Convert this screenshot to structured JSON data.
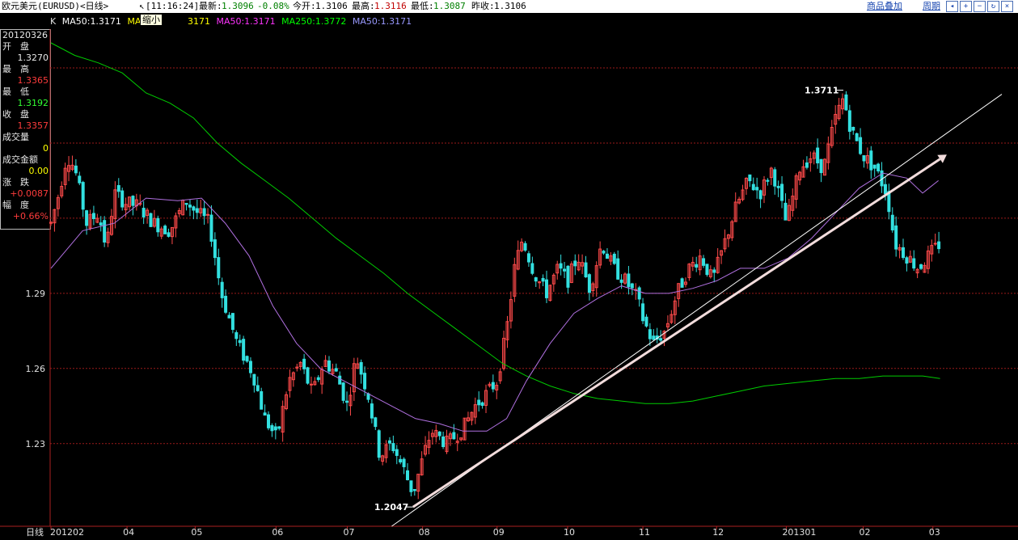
{
  "header": {
    "title": "欧元美元(EURUSD)<日线>",
    "time": "[11:16:24]",
    "latest_label": "最新:",
    "latest": "1.3096",
    "change": "-0.08%",
    "open_label": "今开:",
    "open": "1.3106",
    "high_label": "最高:",
    "high": "1.3116",
    "low_label": "最低:",
    "low": "1.3087",
    "prev_label": "昨收:",
    "prev": "1.3106",
    "overlay_link": "商品叠加",
    "period_link": "周期"
  },
  "tooltip": "缩小",
  "legend": [
    {
      "text": "K",
      "color": "#e0e0e0"
    },
    {
      "text": "MA50:1.3171",
      "color": "#ffffff"
    },
    {
      "text": "MA",
      "color": "#ffff00"
    },
    {
      "text": "3171",
      "color": "#ffff00"
    },
    {
      "text": "MA50:1.3171",
      "color": "#ff33ff"
    },
    {
      "text": "MA250:1.3772",
      "color": "#00ff00"
    },
    {
      "text": "MA50:1.3171",
      "color": "#9999ff"
    }
  ],
  "info_panel": {
    "date": "20120326",
    "rows": [
      {
        "label": "开　盘",
        "value": "1.3270",
        "color": "#e8e8e8"
      },
      {
        "label": "最　高",
        "value": "1.3365",
        "color": "#ff3c3c"
      },
      {
        "label": "最　低",
        "value": "1.3192",
        "color": "#33ff33"
      },
      {
        "label": "收　盘",
        "value": "1.3357",
        "color": "#ff3c3c"
      },
      {
        "label": "成交量",
        "value": "0",
        "color": "#ffff00"
      },
      {
        "label": "成交金额",
        "value": "0.00",
        "color": "#ffff00"
      },
      {
        "label": "涨　跌",
        "value": "+0.0087",
        "color": "#ff3c3c"
      },
      {
        "label": "幅　度",
        "value": "+0.66%",
        "color": "#ff3c3c"
      }
    ]
  },
  "chart_data": {
    "type": "candlestick",
    "ylim": [
      1.197,
      1.3955
    ],
    "yticks": [
      1.23,
      1.26,
      1.29
    ],
    "ytick_labels": [
      "1.23",
      "1.26",
      "1.29"
    ],
    "gridlines": [
      1.23,
      1.26,
      1.29,
      1.32,
      1.35,
      1.38
    ],
    "xaxis_label": "日线",
    "xticks": [
      {
        "label": "201202",
        "x": 0
      },
      {
        "label": "04",
        "x": 0.096
      },
      {
        "label": "05",
        "x": 0.182
      },
      {
        "label": "06",
        "x": 0.284
      },
      {
        "label": "07",
        "x": 0.374
      },
      {
        "label": "08",
        "x": 0.469
      },
      {
        "label": "09",
        "x": 0.563
      },
      {
        "label": "10",
        "x": 0.652
      },
      {
        "label": "11",
        "x": 0.747
      },
      {
        "label": "12",
        "x": 0.84
      },
      {
        "label": "201301",
        "x": 0.928
      },
      {
        "label": "02",
        "x": 1.025
      },
      {
        "label": "03",
        "x": 1.113
      }
    ],
    "annotations": [
      {
        "text": "1.3711",
        "x": 1.0,
        "value": 1.3711
      },
      {
        "text": "1.2047",
        "x": 0.457,
        "value": 1.2047
      }
    ],
    "price_path": [
      [
        0.0,
        1.318
      ],
      [
        0.01,
        1.33
      ],
      [
        0.02,
        1.345
      ],
      [
        0.03,
        1.34
      ],
      [
        0.045,
        1.318
      ],
      [
        0.06,
        1.322
      ],
      [
        0.07,
        1.308
      ],
      [
        0.08,
        1.33
      ],
      [
        0.095,
        1.326
      ],
      [
        0.11,
        1.325
      ],
      [
        0.13,
        1.318
      ],
      [
        0.15,
        1.315
      ],
      [
        0.17,
        1.327
      ],
      [
        0.182,
        1.323
      ],
      [
        0.2,
        1.318
      ],
      [
        0.215,
        1.29
      ],
      [
        0.235,
        1.27
      ],
      [
        0.255,
        1.258
      ],
      [
        0.27,
        1.24
      ],
      [
        0.285,
        1.232
      ],
      [
        0.3,
        1.255
      ],
      [
        0.315,
        1.262
      ],
      [
        0.33,
        1.25
      ],
      [
        0.345,
        1.263
      ],
      [
        0.36,
        1.258
      ],
      [
        0.374,
        1.245
      ],
      [
        0.385,
        1.265
      ],
      [
        0.4,
        1.25
      ],
      [
        0.415,
        1.225
      ],
      [
        0.43,
        1.23
      ],
      [
        0.445,
        1.22
      ],
      [
        0.457,
        1.21
      ],
      [
        0.47,
        1.225
      ],
      [
        0.48,
        1.235
      ],
      [
        0.5,
        1.23
      ],
      [
        0.52,
        1.236
      ],
      [
        0.535,
        1.245
      ],
      [
        0.55,
        1.25
      ],
      [
        0.563,
        1.255
      ],
      [
        0.575,
        1.275
      ],
      [
        0.585,
        1.3
      ],
      [
        0.595,
        1.312
      ],
      [
        0.61,
        1.298
      ],
      [
        0.625,
        1.29
      ],
      [
        0.64,
        1.3
      ],
      [
        0.652,
        1.295
      ],
      [
        0.665,
        1.305
      ],
      [
        0.68,
        1.292
      ],
      [
        0.695,
        1.31
      ],
      [
        0.71,
        1.3
      ],
      [
        0.725,
        1.295
      ],
      [
        0.74,
        1.288
      ],
      [
        0.747,
        1.28
      ],
      [
        0.76,
        1.27
      ],
      [
        0.775,
        1.275
      ],
      [
        0.79,
        1.29
      ],
      [
        0.805,
        1.3
      ],
      [
        0.82,
        1.305
      ],
      [
        0.835,
        1.295
      ],
      [
        0.85,
        1.31
      ],
      [
        0.865,
        1.325
      ],
      [
        0.88,
        1.335
      ],
      [
        0.895,
        1.33
      ],
      [
        0.91,
        1.34
      ],
      [
        0.928,
        1.318
      ],
      [
        0.945,
        1.34
      ],
      [
        0.96,
        1.345
      ],
      [
        0.975,
        1.34
      ],
      [
        0.99,
        1.36
      ],
      [
        1.0,
        1.368
      ],
      [
        1.01,
        1.355
      ],
      [
        1.025,
        1.345
      ],
      [
        1.04,
        1.34
      ],
      [
        1.055,
        1.33
      ],
      [
        1.065,
        1.31
      ],
      [
        1.08,
        1.305
      ],
      [
        1.095,
        1.3
      ],
      [
        1.11,
        1.306
      ],
      [
        1.122,
        1.31
      ]
    ],
    "ma_purple": [
      [
        0.0,
        1.3
      ],
      [
        0.04,
        1.315
      ],
      [
        0.08,
        1.318
      ],
      [
        0.12,
        1.328
      ],
      [
        0.16,
        1.327
      ],
      [
        0.19,
        1.328
      ],
      [
        0.22,
        1.318
      ],
      [
        0.25,
        1.305
      ],
      [
        0.28,
        1.285
      ],
      [
        0.31,
        1.27
      ],
      [
        0.34,
        1.26
      ],
      [
        0.37,
        1.255
      ],
      [
        0.4,
        1.25
      ],
      [
        0.43,
        1.245
      ],
      [
        0.46,
        1.24
      ],
      [
        0.49,
        1.238
      ],
      [
        0.52,
        1.235
      ],
      [
        0.55,
        1.235
      ],
      [
        0.575,
        1.24
      ],
      [
        0.6,
        1.255
      ],
      [
        0.63,
        1.27
      ],
      [
        0.66,
        1.282
      ],
      [
        0.69,
        1.288
      ],
      [
        0.72,
        1.293
      ],
      [
        0.75,
        1.29
      ],
      [
        0.78,
        1.29
      ],
      [
        0.81,
        1.292
      ],
      [
        0.84,
        1.295
      ],
      [
        0.87,
        1.3
      ],
      [
        0.9,
        1.3
      ],
      [
        0.93,
        1.304
      ],
      [
        0.96,
        1.312
      ],
      [
        0.99,
        1.322
      ],
      [
        1.02,
        1.332
      ],
      [
        1.05,
        1.338
      ],
      [
        1.08,
        1.336
      ],
      [
        1.1,
        1.33
      ],
      [
        1.12,
        1.335
      ]
    ],
    "ma_green": [
      [
        0.0,
        1.39
      ],
      [
        0.03,
        1.385
      ],
      [
        0.06,
        1.382
      ],
      [
        0.09,
        1.378
      ],
      [
        0.12,
        1.37
      ],
      [
        0.15,
        1.366
      ],
      [
        0.18,
        1.36
      ],
      [
        0.21,
        1.35
      ],
      [
        0.24,
        1.342
      ],
      [
        0.27,
        1.335
      ],
      [
        0.3,
        1.328
      ],
      [
        0.33,
        1.32
      ],
      [
        0.36,
        1.312
      ],
      [
        0.39,
        1.305
      ],
      [
        0.42,
        1.298
      ],
      [
        0.45,
        1.29
      ],
      [
        0.48,
        1.283
      ],
      [
        0.51,
        1.276
      ],
      [
        0.54,
        1.269
      ],
      [
        0.57,
        1.262
      ],
      [
        0.6,
        1.257
      ],
      [
        0.63,
        1.253
      ],
      [
        0.66,
        1.25
      ],
      [
        0.69,
        1.248
      ],
      [
        0.72,
        1.247
      ],
      [
        0.75,
        1.246
      ],
      [
        0.78,
        1.246
      ],
      [
        0.81,
        1.247
      ],
      [
        0.84,
        1.249
      ],
      [
        0.87,
        1.251
      ],
      [
        0.9,
        1.253
      ],
      [
        0.93,
        1.254
      ],
      [
        0.96,
        1.255
      ],
      [
        0.99,
        1.256
      ],
      [
        1.02,
        1.256
      ],
      [
        1.05,
        1.257
      ],
      [
        1.08,
        1.257
      ],
      [
        1.1,
        1.257
      ],
      [
        1.122,
        1.256
      ]
    ],
    "trendline": {
      "from": [
        0.457,
        1.2047
      ],
      "to": [
        1.122,
        1.3436
      ]
    },
    "thin_line": {
      "from": [
        0.43,
        1.197
      ],
      "to": [
        1.2,
        1.3695
      ]
    }
  }
}
